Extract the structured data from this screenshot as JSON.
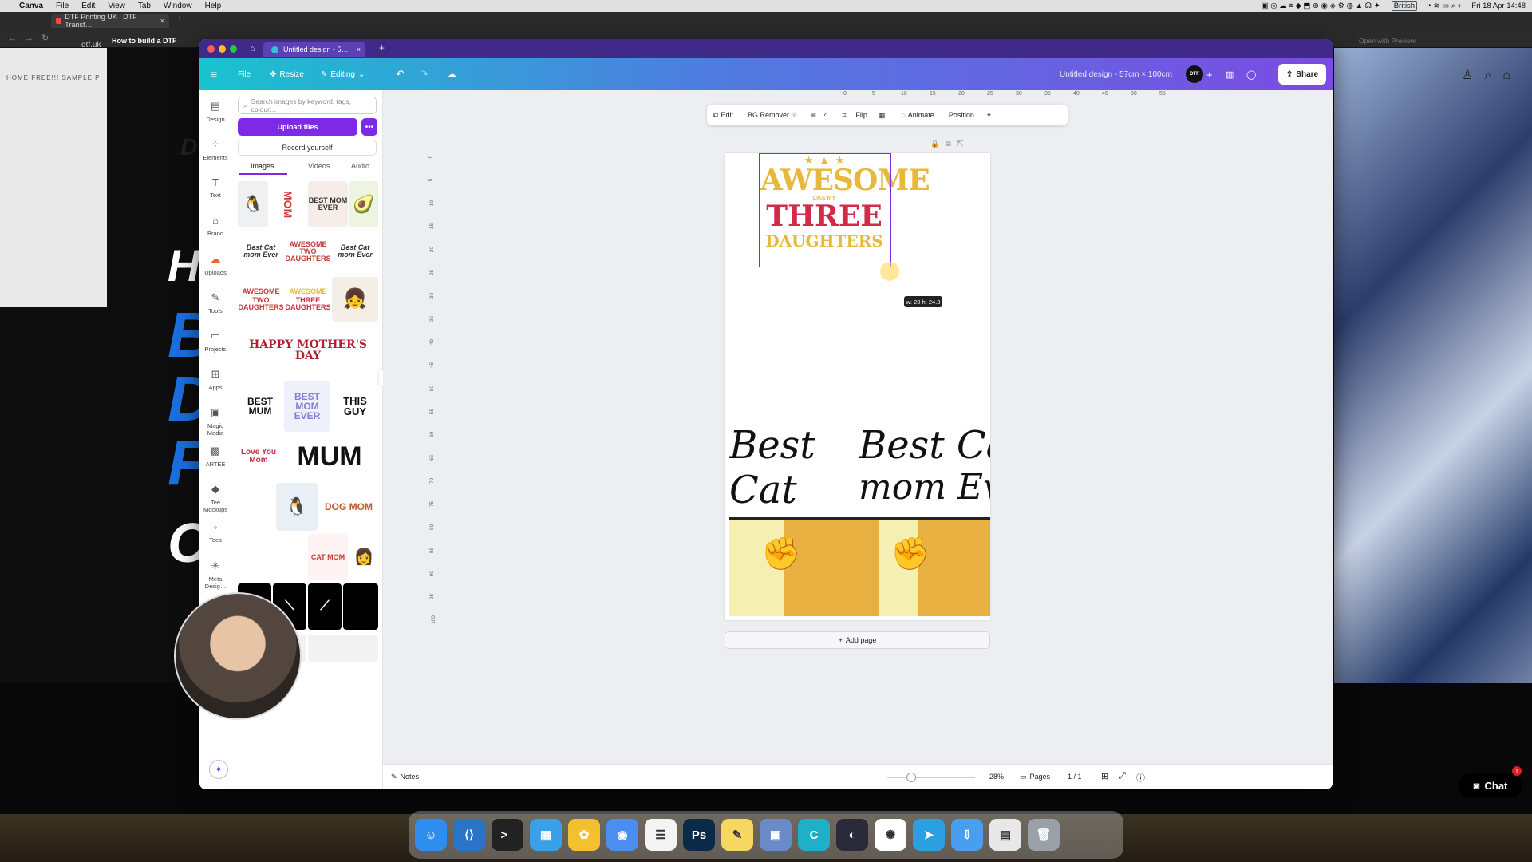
{
  "menubar": {
    "app": "Canva",
    "items": [
      "File",
      "Edit",
      "View",
      "Tab",
      "Window",
      "Help"
    ],
    "input_source": "British",
    "clock": "Fri 18 Apr  14:48"
  },
  "browser": {
    "tab_title": "DTF Printing UK | DTF Transf…",
    "address": "dtf.uk",
    "bookmark": "How to build a DTF",
    "open_with_preview": "Open with Preview",
    "site_nav": "HOME     FREE!!! SAMPLE P"
  },
  "canva": {
    "tab_title": "Untitled design - 5…",
    "toolbar": {
      "file": "File",
      "resize": "Resize",
      "editing": "Editing",
      "doc_title": "Untitled design - 57cm × 100cm",
      "share": "Share",
      "avatar": "DTF"
    },
    "rail": [
      {
        "label": "Design",
        "icon": "design-icon"
      },
      {
        "label": "Elements",
        "icon": "elements-icon"
      },
      {
        "label": "Text",
        "icon": "text-icon"
      },
      {
        "label": "Brand",
        "icon": "brand-icon"
      },
      {
        "label": "Uploads",
        "icon": "uploads-icon"
      },
      {
        "label": "Tools",
        "icon": "tools-icon"
      },
      {
        "label": "Projects",
        "icon": "projects-icon"
      },
      {
        "label": "Apps",
        "icon": "apps-icon"
      },
      {
        "label": "Magic Media",
        "icon": "magic-media-icon"
      },
      {
        "label": "ARTEE",
        "icon": "artee-icon"
      },
      {
        "label": "Tee Mockups",
        "icon": "tee-mockups-icon"
      },
      {
        "label": "Tees",
        "icon": "tees-icon"
      },
      {
        "label": "Meta Desig…",
        "icon": "meta-design-icon"
      }
    ],
    "panel": {
      "search_placeholder": "Search images by keyword, tags, colour…",
      "upload": "Upload files",
      "record": "Record yourself",
      "tabs": [
        "Images",
        "Videos",
        "Audio"
      ],
      "thumbs": {
        "mom": "MOM",
        "best_dinosaur": "BEST MOM EVER",
        "best_cat": "Best Cat mom Ever",
        "awesome_two": "AWESOME TWO DAUGHTERS",
        "awesome": "AWESOME",
        "two_daughters": "TWO DAUGHTERS",
        "three_daughters": "THREE DAUGHTERS",
        "happy": "HAPPY MOTHER'S DAY",
        "best_mum": "BEST MUM",
        "best_mom_ever": "BEST MOM EVER",
        "this_guy": "THIS GUY",
        "love_you_mom": "Love You Mom",
        "mum": "MUM",
        "dog_mom": "DOG MOM",
        "cat_mom": "CAT MOM"
      }
    },
    "context_bar": {
      "edit": "Edit",
      "bg_remover": "BG Remover",
      "flip": "Flip",
      "animate": "Animate",
      "position": "Position"
    },
    "ruler": [
      "0",
      "5",
      "10",
      "15",
      "20",
      "25",
      "30",
      "35",
      "40",
      "45",
      "50",
      "55"
    ],
    "vruler": [
      "0",
      "5",
      "10",
      "15",
      "20",
      "25",
      "30",
      "35",
      "40",
      "45",
      "50",
      "55",
      "60",
      "65",
      "70",
      "75",
      "80",
      "85",
      "90",
      "95",
      "100"
    ],
    "canvas": {
      "awesome": "AWESOME",
      "like_my": "LIKE MY",
      "three": "THREE",
      "daughters": "DAUGHTERS",
      "best_cat": "Best Cat",
      "mom_ever": "mom Ever",
      "size_tip": "w: 28 h: 24.3",
      "add_page": "Add page"
    },
    "footer": {
      "notes": "Notes",
      "zoom": "28%",
      "pages": "Pages",
      "page_count": "1 / 1"
    }
  },
  "chat": {
    "label": "Chat",
    "badge": "1"
  },
  "dock": [
    "Finder",
    "VS Code",
    "Terminal",
    "Calendar",
    "Photos",
    "Chrome",
    "Reminders",
    "Ps",
    "Notes",
    "Preview",
    "Canva",
    "DaVinci",
    "ChatGPT",
    "Telegram",
    "Downloads",
    "Files",
    "Trash"
  ],
  "colors": {
    "canva_purple": "#7d2ae8",
    "awesome_gold": "#e8b83a",
    "three_red": "#d22a4a"
  }
}
